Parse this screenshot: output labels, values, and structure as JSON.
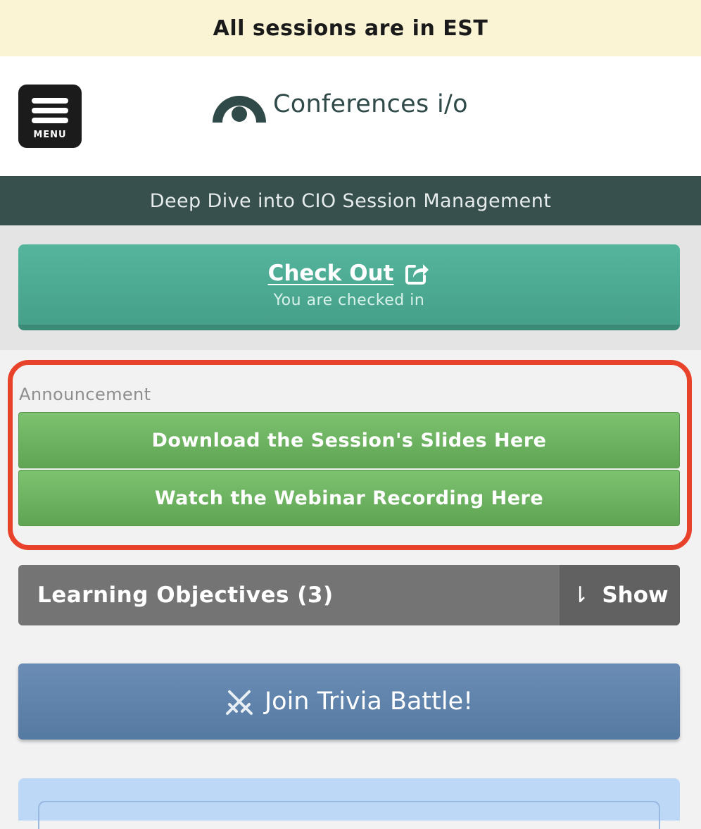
{
  "timezone_banner": "All sessions are in EST",
  "header": {
    "menu_label": "MENU",
    "logo_text": "Conferences i/o"
  },
  "session": {
    "title": "Deep Dive into CIO Session Management"
  },
  "checkin": {
    "button_label": "Check Out",
    "status": "You are checked in"
  },
  "announcement": {
    "title": "Announcement",
    "buttons": [
      {
        "label": "Download the Session's Slides Here"
      },
      {
        "label": "Watch the Webinar Recording Here"
      }
    ]
  },
  "learning_objectives": {
    "label": "Learning Objectives (3)",
    "toggle_label": "Show",
    "toggle_arrow": "⇂"
  },
  "trivia": {
    "label": "Join Trivia Battle!"
  },
  "colors": {
    "banner_bg": "#faf3d4",
    "session_bar": "#374f4d",
    "checkout_green": "#55b59c",
    "announce_border": "#e8432a",
    "announce_button": "#6fb562",
    "objectives_bg": "#747474",
    "trivia_blue": "#6284ad"
  }
}
